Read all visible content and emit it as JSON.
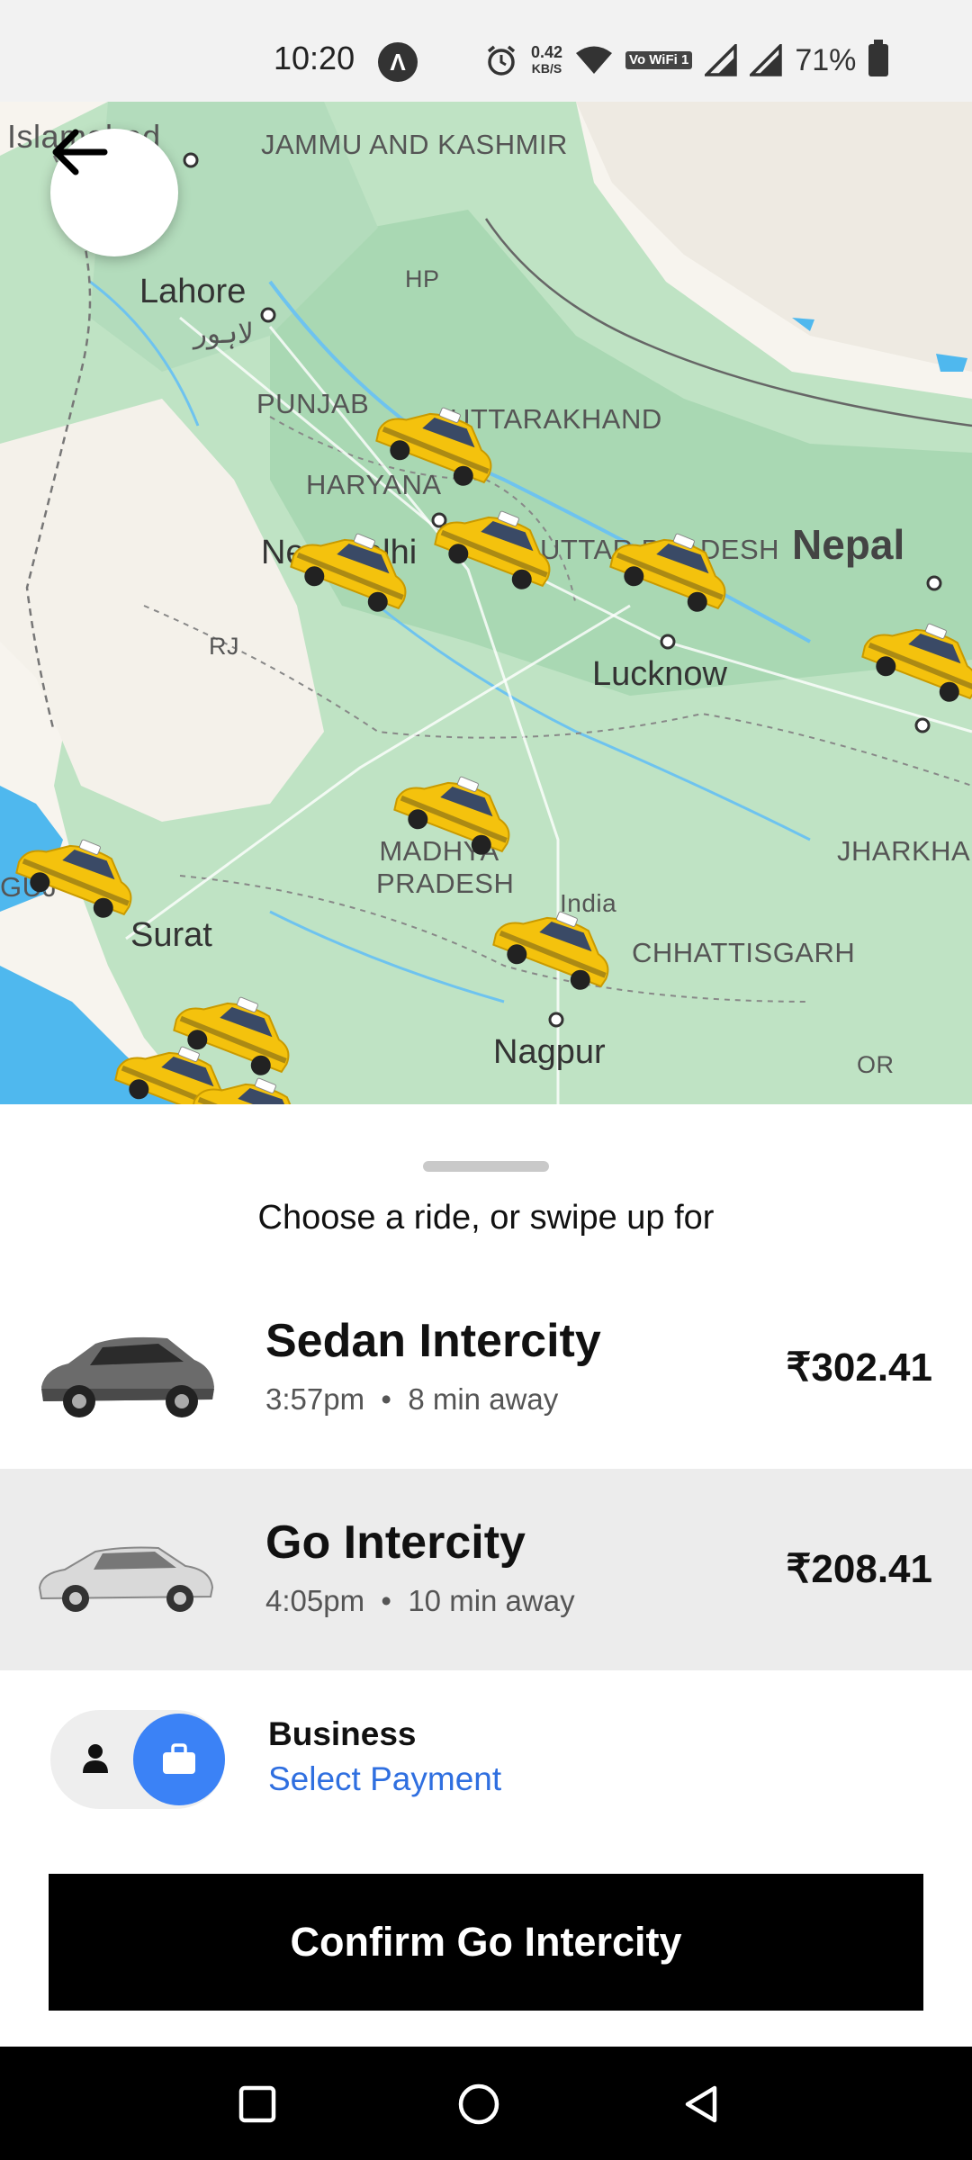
{
  "status_bar": {
    "time": "10:20",
    "nav_badge": "Λ",
    "net_speed_value": "0.42",
    "net_speed_unit": "KB/S",
    "volte": "Vo WiFi 1",
    "battery_percent": "71%"
  },
  "map": {
    "labels": {
      "islamabad": "Islamabad",
      "jammu_kashmir": "JAMMU AND KASHMIR",
      "lahore": "Lahore",
      "lahore_urdu": "لاہور",
      "hp": "HP",
      "punjab": "PUNJAB",
      "uttarakhand": "UTTARAKHAND",
      "haryana": "HARYANA",
      "new_delhi": "New Delhi",
      "uttar_pradesh": "UTTAR PRADESH",
      "nepal": "Nepal",
      "rj": "RJ",
      "lucknow": "Lucknow",
      "madhya_pradesh": "MADHYA PRADESH",
      "india": "India",
      "jharkhand": "JHARKHAND",
      "chhattisgarh": "CHHATTISGARH",
      "surat": "Surat",
      "gujarat": "GUJ",
      "nagpur": "Nagpur",
      "odisha": "OR"
    }
  },
  "sheet": {
    "hint": "Choose a ride, or swipe up for"
  },
  "rides": [
    {
      "name": "Sedan Intercity",
      "time": "3:57pm",
      "separator": "•",
      "eta": "8 min away",
      "price": "₹302.41",
      "selected": false
    },
    {
      "name": "Go Intercity",
      "time": "4:05pm",
      "separator": "•",
      "eta": "10 min away",
      "price": "₹208.41",
      "selected": true
    }
  ],
  "payment": {
    "title": "Business",
    "link": "Select Payment",
    "accent": "#3b82f6"
  },
  "confirm_button": "Confirm Go Intercity",
  "colors": {
    "map_green": "#b9dfc0",
    "map_water": "#4fb8ee",
    "selected_row": "#ececec",
    "link": "#2f6fe0"
  }
}
